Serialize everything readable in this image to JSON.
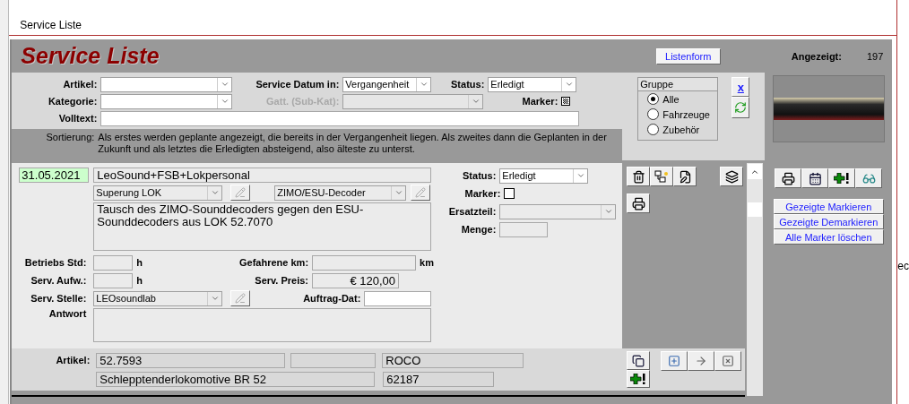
{
  "window": {
    "title": "Service Liste"
  },
  "header": {
    "title": "Service Liste",
    "list_button": "Listenform",
    "shown_label": "Angezeigt:",
    "shown_count": "197"
  },
  "filters": {
    "article": {
      "label": "Artikel:"
    },
    "service_date": {
      "label": "Service Datum in:",
      "value": "Vergangenheit"
    },
    "status": {
      "label": "Status:",
      "value": "Erledigt"
    },
    "category": {
      "label": "Kategorie:"
    },
    "sub_category": {
      "label": "Gatt. (Sub-Kat):",
      "disabled": true
    },
    "marker": {
      "label": "Marker:",
      "indeterminate": true
    },
    "fulltext": {
      "label": "Volltext:"
    }
  },
  "sort_note": {
    "label": "Sortierung:",
    "text": "Als erstes werden geplante angezeigt, die bereits in der Vergangenheit liegen. Als zweites dann die Geplanten in der Zukunft und als letztes die Erledigten absteigend, also älteste zu unterst."
  },
  "group": {
    "title": "Gruppe",
    "options": [
      {
        "label": "Alle",
        "selected": true
      },
      {
        "label": "Fahrzeuge",
        "selected": false
      },
      {
        "label": "Zubehör",
        "selected": false
      }
    ]
  },
  "clear_button": "x",
  "record": {
    "date": "31.05.2021",
    "title": "LeoSound+FSB+Lokpersonal",
    "category": "Superung LOK",
    "subcategory": "ZIMO/ESU-Decoder",
    "description": "Tausch des ZIMO-Sounddecoders gegen den ESU-Sounddecoders aus LOK 52.7070",
    "status_label": "Status:",
    "status": "Erledigt",
    "marker_label": "Marker:",
    "marker_checked": false,
    "spare_part_label": "Ersatzteil:",
    "quantity_label": "Menge:",
    "hours_label": "Betriebs Std:",
    "hours_unit": "h",
    "km_label": "Gefahrene km:",
    "km_unit": "km",
    "effort_label": "Serv. Aufw.:",
    "effort_unit": "h",
    "price_label": "Serv. Preis:",
    "price": "€ 120,00",
    "service_point_label": "Serv. Stelle:",
    "service_point": "LEOsoundlab",
    "order_date_label": "Auftrag-Dat:",
    "answer_label": "Antwort"
  },
  "article": {
    "label": "Artikel:",
    "number": "52.7593",
    "manufacturer": "ROCO",
    "name": "Schlepptenderlokomotive BR 52",
    "code": "62187"
  },
  "marker_buttons": [
    "Gezeigte Markieren",
    "Gezeigte Demarkieren",
    "Alle Marker löschen"
  ],
  "background_window": {
    "text": "ec"
  }
}
